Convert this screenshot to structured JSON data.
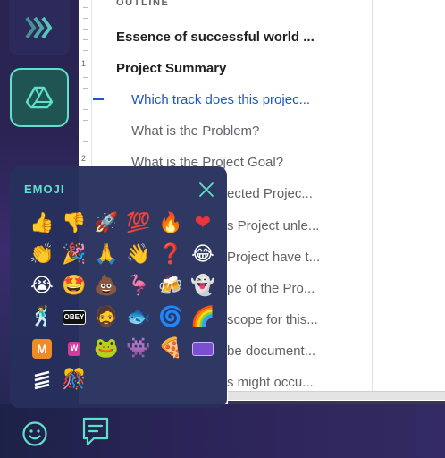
{
  "outline": {
    "heading": "OUTLINE",
    "items": [
      {
        "label": "Essence of successful world ...",
        "level": 1
      },
      {
        "label": "Project Summary",
        "level": 1
      },
      {
        "label": "Which track does this projec...",
        "level": 2,
        "active": true
      },
      {
        "label": "What is the Problem?",
        "level": 2
      },
      {
        "label": "What is the Project Goal?",
        "level": 2
      },
      {
        "label": "ected Projec...",
        "level": 2
      },
      {
        "label": "s Project unle...",
        "level": 2
      },
      {
        "label": "Project have t...",
        "level": 2
      },
      {
        "label": "pe of the Pro...",
        "level": 2
      },
      {
        "label": "scope for this...",
        "level": 2
      },
      {
        "label": "be document...",
        "level": 2
      },
      {
        "label": "s might occu...",
        "level": 2
      }
    ]
  },
  "ruler": {
    "numbers": [
      "1",
      "2"
    ]
  },
  "emoji_panel": {
    "title": "EMOJI",
    "close_icon": "close-icon",
    "emojis": [
      {
        "name": "thumbs-up",
        "glyph": "👍"
      },
      {
        "name": "thumbs-down",
        "glyph": "👎"
      },
      {
        "name": "rocket",
        "glyph": "🚀"
      },
      {
        "name": "hundred-points",
        "glyph": "💯"
      },
      {
        "name": "fire",
        "glyph": "🔥"
      },
      {
        "name": "red-heart",
        "glyph": "❤"
      },
      {
        "name": "clapping-hands",
        "glyph": "👏"
      },
      {
        "name": "party-popper",
        "glyph": "🎉"
      },
      {
        "name": "folded-hands",
        "glyph": "🙏"
      },
      {
        "name": "waving-hand",
        "glyph": "👋"
      },
      {
        "name": "question-mark",
        "glyph": "❓"
      },
      {
        "name": "tears-of-joy",
        "glyph": "😂"
      },
      {
        "name": "crying-face",
        "glyph": "😭"
      },
      {
        "name": "star-struck",
        "glyph": "🤩"
      },
      {
        "name": "pile-of-poo",
        "glyph": "💩"
      },
      {
        "name": "flamingo",
        "glyph": "🦩"
      },
      {
        "name": "beer-mugs",
        "glyph": "🍻"
      },
      {
        "name": "ghost",
        "glyph": "👻"
      },
      {
        "name": "dancing-man",
        "glyph": "🕺"
      },
      {
        "name": "obey-sticker",
        "glyph": ""
      },
      {
        "name": "portrait-sticker",
        "glyph": "🧔"
      },
      {
        "name": "small-sticker",
        "glyph": "🐟"
      },
      {
        "name": "blue-stack-sticker",
        "glyph": "🌀"
      },
      {
        "name": "rainbow-sticker",
        "glyph": "🌈"
      },
      {
        "name": "m-logo-sticker",
        "glyph": ""
      },
      {
        "name": "pink-sticker",
        "glyph": ""
      },
      {
        "name": "pepe-frog",
        "glyph": "🐸"
      },
      {
        "name": "space-invader",
        "glyph": "👾"
      },
      {
        "name": "pizza",
        "glyph": "🍕"
      },
      {
        "name": "purple-sign-sticker",
        "glyph": ""
      },
      {
        "name": "stacked-logo-sticker",
        "glyph": ""
      },
      {
        "name": "party-character-sticker",
        "glyph": "🎊"
      }
    ],
    "sticker_text": {
      "obey": "OBEY",
      "m_logo": "M",
      "pink": "W"
    }
  },
  "bottom_bar": {
    "icons": [
      "smiley-icon",
      "chat-bubble-icon"
    ]
  },
  "colors": {
    "accent": "#5fe0c8",
    "link": "#1a57c7",
    "panel": "#26305c"
  }
}
